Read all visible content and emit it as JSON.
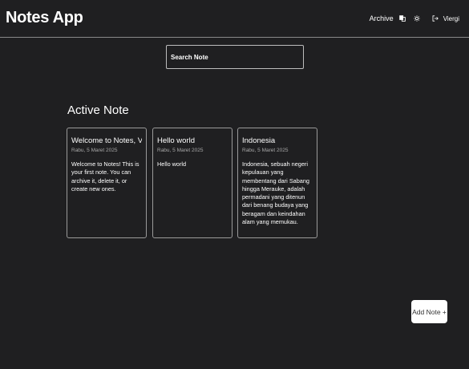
{
  "header": {
    "title": "Notes App",
    "archive_label": "Archive",
    "user_name": "Viergi",
    "icons": [
      "translate-icon",
      "theme-toggle-icon",
      "logout-icon"
    ]
  },
  "search": {
    "placeholder": "Search Note"
  },
  "section": {
    "title": "Active Note"
  },
  "notes": [
    {
      "title": "Welcome to Notes, Viergi!",
      "date": "Rabu, 5 Maret 2025",
      "body": "Welcome to Notes! This is your first note. You can archive it, delete it, or create new ones."
    },
    {
      "title": "Hello world",
      "date": "Rabu, 5 Maret 2025",
      "body": "Hello world"
    },
    {
      "title": "Indonesia",
      "date": "Rabu, 5 Maret 2025",
      "body": "Indonesia, sebuah negeri kepulauan yang membentang dari Sabang hingga Merauke, adalah permadani yang ditenun dari benang budaya yang beragam dan keindahan alam yang memukau."
    }
  ],
  "add_button": {
    "label": "Add Note +"
  }
}
